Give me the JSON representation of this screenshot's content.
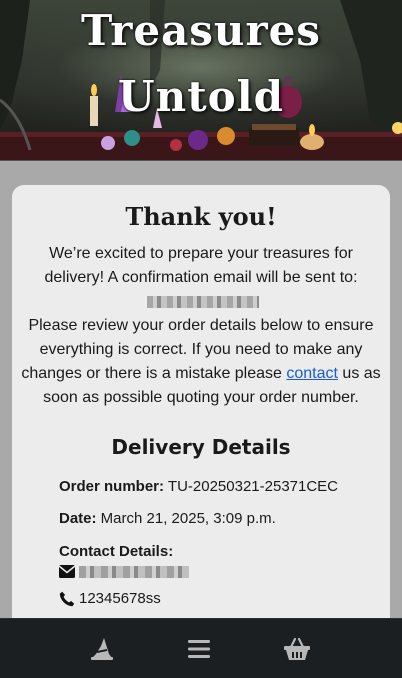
{
  "hero": {
    "title_line1": "Treasures",
    "title_line2": "Untold"
  },
  "confirmation": {
    "heading": "Thank you!",
    "intro": "We’re excited to prepare your treasures for delivery! A confirmation email will be sent to:",
    "review_before": "Please review your order details below to ensure everything is correct. If you need to make any changes or there is a mistake please ",
    "contact_link": "contact",
    "review_after": " us as soon as possible quoting your order number."
  },
  "delivery": {
    "title": "Delivery Details",
    "order_label": "Order number:",
    "order_value": " TU-20250321-25371CEC",
    "date_label": "Date:",
    "date_value": " March 21, 2025, 3:09 p.m.",
    "contact_label": "Contact Details:",
    "phone": "12345678ss"
  },
  "nav": {
    "items": [
      "home",
      "menu",
      "basket"
    ]
  },
  "colors": {
    "page_bg": "#a9a9a9",
    "card_bg": "#ececec",
    "nav_bg": "#1b1f22",
    "nav_icon": "#b8b8b8",
    "link": "#1a5bd6"
  },
  "icons": {
    "home": "wizard-hat-icon",
    "menu": "hamburger-icon",
    "basket": "shopping-basket-icon",
    "email": "envelope-icon",
    "phone": "phone-icon"
  }
}
